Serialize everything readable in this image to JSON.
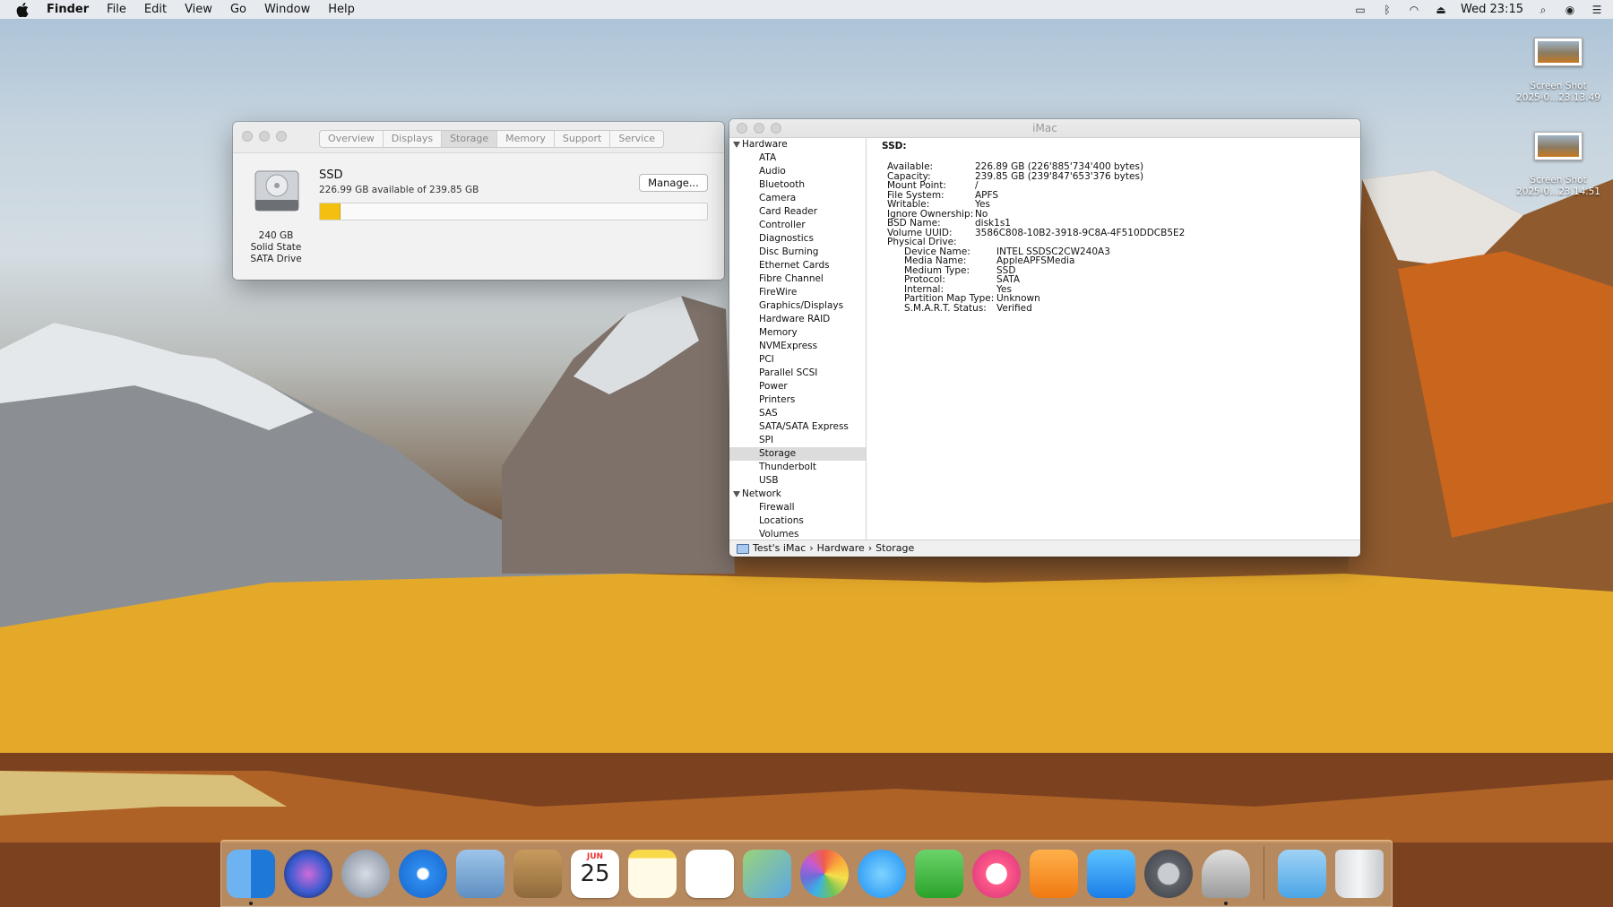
{
  "menubar": {
    "app": "Finder",
    "items": [
      "File",
      "Edit",
      "View",
      "Go",
      "Window",
      "Help"
    ],
    "clock": "Wed 23:15"
  },
  "about": {
    "tabs": [
      "Overview",
      "Displays",
      "Storage",
      "Memory",
      "Support",
      "Service"
    ],
    "selected_tab": "Storage",
    "drive_caption": [
      "240 GB",
      "Solid State",
      "SATA Drive"
    ],
    "name": "SSD",
    "subtitle": "226.99 GB available of 239.85 GB",
    "manage_label": "Manage...",
    "used_fraction": 0.054,
    "bar_color": "#f3c012"
  },
  "sysinfo": {
    "title": "iMac",
    "sidebar_groups": [
      {
        "name": "Hardware",
        "items": [
          "ATA",
          "Audio",
          "Bluetooth",
          "Camera",
          "Card Reader",
          "Controller",
          "Diagnostics",
          "Disc Burning",
          "Ethernet Cards",
          "Fibre Channel",
          "FireWire",
          "Graphics/Displays",
          "Hardware RAID",
          "Memory",
          "NVMExpress",
          "PCI",
          "Parallel SCSI",
          "Power",
          "Printers",
          "SAS",
          "SATA/SATA Express",
          "SPI",
          "Storage",
          "Thunderbolt",
          "USB"
        ]
      },
      {
        "name": "Network",
        "items": [
          "Firewall",
          "Locations",
          "Volumes"
        ]
      }
    ],
    "selected_item": "Storage",
    "detail_heading": "SSD:",
    "detail_rows": [
      {
        "k": "Available:",
        "v": "226.89 GB (226'885'734'400 bytes)"
      },
      {
        "k": "Capacity:",
        "v": "239.85 GB (239'847'653'376 bytes)"
      },
      {
        "k": "Mount Point:",
        "v": "/"
      },
      {
        "k": "File System:",
        "v": "APFS"
      },
      {
        "k": "Writable:",
        "v": "Yes"
      },
      {
        "k": "Ignore Ownership:",
        "v": "No"
      },
      {
        "k": "BSD Name:",
        "v": "disk1s1"
      },
      {
        "k": "Volume UUID:",
        "v": "3586C808-10B2-3918-9C8A-4F510DDCB5E2"
      },
      {
        "k": "Physical Drive:",
        "v": ""
      }
    ],
    "physical_rows": [
      {
        "k": "Device Name:",
        "v": "INTEL SSDSC2CW240A3"
      },
      {
        "k": "Media Name:",
        "v": "AppleAPFSMedia"
      },
      {
        "k": "Medium Type:",
        "v": "SSD"
      },
      {
        "k": "Protocol:",
        "v": "SATA"
      },
      {
        "k": "Internal:",
        "v": "Yes"
      },
      {
        "k": "Partition Map Type:",
        "v": "Unknown"
      },
      {
        "k": "S.M.A.R.T. Status:",
        "v": "Verified"
      }
    ],
    "path": [
      "Test's iMac",
      "Hardware",
      "Storage"
    ]
  },
  "desktop_icons": [
    {
      "label1": "Screen Shot",
      "label2": "2025-0...23.13.49"
    },
    {
      "label1": "Screen Shot",
      "label2": "2025-0...23.14.51"
    }
  ],
  "dock": {
    "calendar_month": "JUN",
    "calendar_day": "25"
  }
}
